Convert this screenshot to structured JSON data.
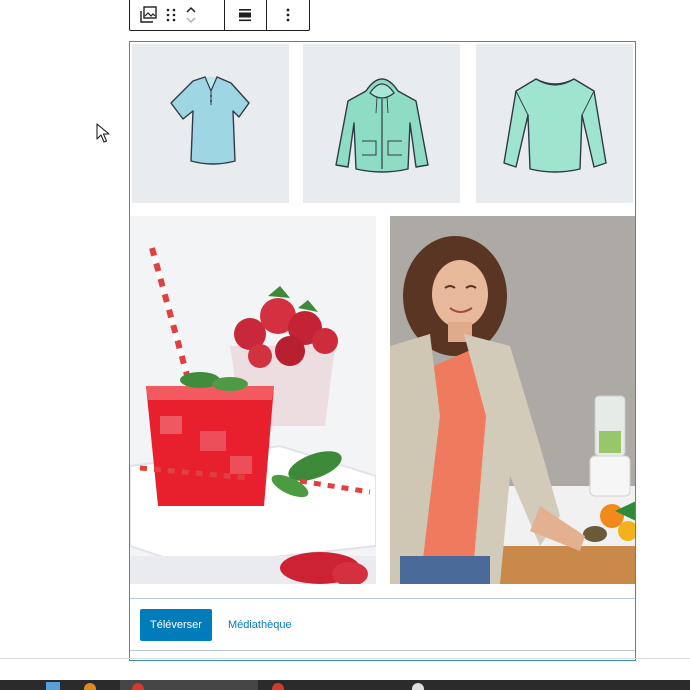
{
  "toolbar": {
    "icons": [
      "gallery-block-icon",
      "drag-handle-icon",
      "move-up-down-icon",
      "align-icon",
      "more-options-icon"
    ]
  },
  "gallery": {
    "thumbnails": [
      {
        "name": "polo-shirt",
        "color": "#9fd6e4"
      },
      {
        "name": "hoodie",
        "color": "#8fdcc4"
      },
      {
        "name": "long-sleeve-shirt",
        "color": "#9ee4cf"
      }
    ],
    "photos": [
      {
        "name": "red-drink-strawberries"
      },
      {
        "name": "woman-in-kitchen"
      }
    ],
    "upload_label": "Téléverser",
    "media_library_label": "Médiathèque"
  },
  "colors": {
    "accent": "#007cba",
    "block_border": "#3b8fb6",
    "thumb_bg": "#e8ecef"
  }
}
